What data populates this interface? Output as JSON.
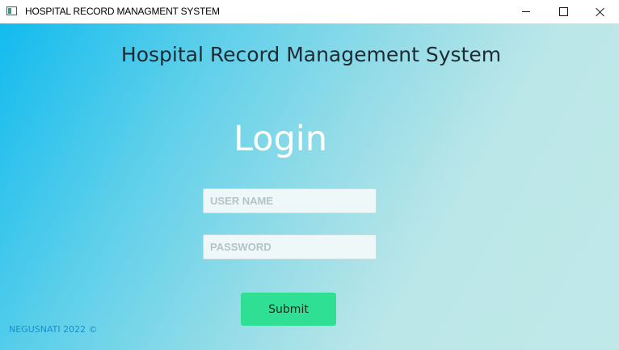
{
  "window": {
    "title": "HOSPITAL RECORD MANAGMENT SYSTEM",
    "icon": "app-window-icon"
  },
  "controls": {
    "minimize_icon": "minimize-icon",
    "maximize_icon": "maximize-icon",
    "close_icon": "close-icon"
  },
  "header": {
    "title": "Hospital Record Management System"
  },
  "login": {
    "heading": "Login",
    "username_placeholder": "USER NAME",
    "username_value": "",
    "password_placeholder": "PASSWORD",
    "password_value": "",
    "submit_label": "Submit"
  },
  "footer": {
    "text": "NEGUSNATI 2022 ©"
  },
  "colors": {
    "gradient_start": "#12bbee",
    "gradient_end": "#bfe8e9",
    "submit_bg": "#2edf94",
    "footer_text": "#1a8fc8"
  }
}
